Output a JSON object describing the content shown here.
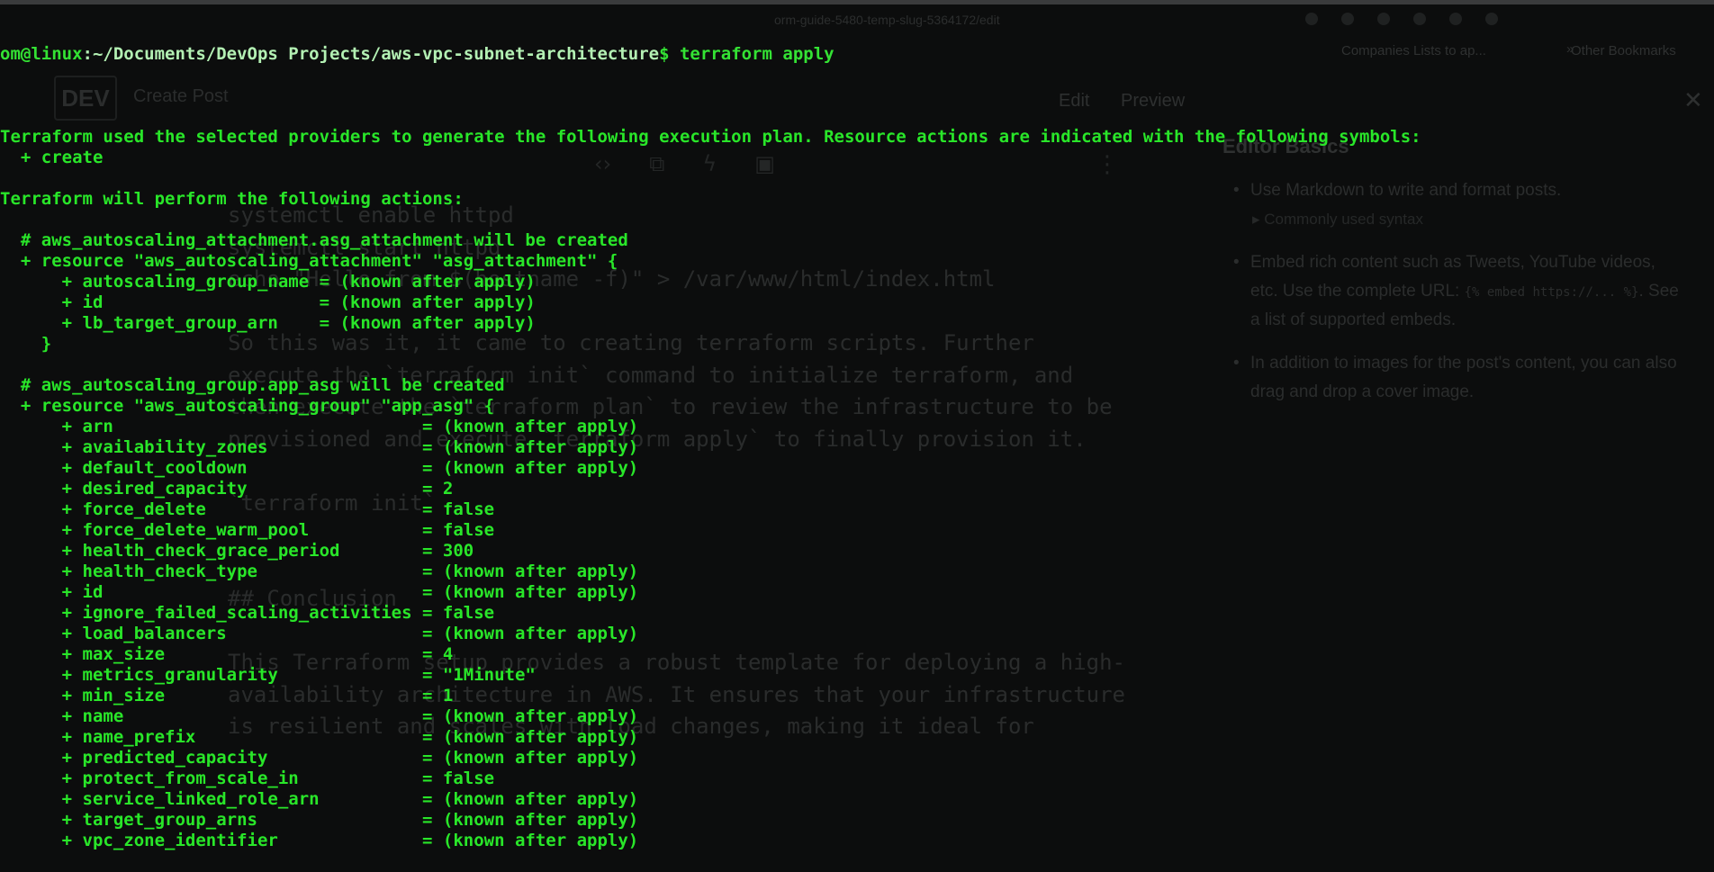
{
  "background": {
    "url_text": "orm-guide-5480-temp-slug-5364172/edit",
    "bookmarks_text": "Companies Lists to ap...",
    "other_bookmarks": "Other Bookmarks",
    "bookmarks_chevron": "»",
    "logo": "DEV",
    "create_post": "Create Post",
    "tab_edit": "Edit",
    "tab_preview": "Preview",
    "close": "✕",
    "toolbar_icons": [
      "‹›",
      "⧉",
      "ϟ",
      "▣"
    ],
    "kebab": "⋮",
    "editor_lines": [
      "systemctl enable httpd",
      "systemctl start httpd",
      "echo \"Hello from $(hostname -f)\" > /var/www/html/index.html",
      "",
      "So this was it, it came to creating terraform scripts. Further",
      "execute the `terraform init` command to initialize terraform, and",
      "then execute the `terraform plan` to review the infrastructure to be",
      "provisioned and execute `terraform apply` to finally provision it.",
      "",
      "`terraform init`",
      "",
      "",
      "## Conclusion",
      "",
      "This Terraform setup provides a robust template for deploying a high-",
      "availability architecture in AWS. It ensures that your infrastructure",
      "is resilient and scales with load changes, making it ideal for"
    ],
    "sidebar": {
      "title": "Editor Basics",
      "item1": "Use Markdown to write and format posts.",
      "item1_sub": "▸ Commonly used syntax",
      "item2_a": "Embed rich content such as Tweets, YouTube videos, etc. Use the complete URL:",
      "item2_code": "{% embed https://... %}",
      "item2_b": ". See a list of supported embeds.",
      "item3": "In addition to images for the post's content, you can also drag and drop a cover image."
    }
  },
  "terminal": {
    "prompt_user": "om@linux",
    "prompt_path": ":~/Documents/DevOps Projects/aws-vpc-subnet-architecture",
    "prompt_cmd": "$ terraform apply",
    "lines": [
      "",
      "Terraform used the selected providers to generate the following execution plan. Resource actions are indicated with the following symbols:",
      "  + create",
      "",
      "Terraform will perform the following actions:",
      "",
      "  # aws_autoscaling_attachment.asg_attachment will be created",
      "  + resource \"aws_autoscaling_attachment\" \"asg_attachment\" {",
      "      + autoscaling_group_name = (known after apply)",
      "      + id                     = (known after apply)",
      "      + lb_target_group_arn    = (known after apply)",
      "    }",
      "",
      "  # aws_autoscaling_group.app_asg will be created",
      "  + resource \"aws_autoscaling_group\" \"app_asg\" {",
      "      + arn                              = (known after apply)",
      "      + availability_zones               = (known after apply)",
      "      + default_cooldown                 = (known after apply)",
      "      + desired_capacity                 = 2",
      "      + force_delete                     = false",
      "      + force_delete_warm_pool           = false",
      "      + health_check_grace_period        = 300",
      "      + health_check_type                = (known after apply)",
      "      + id                               = (known after apply)",
      "      + ignore_failed_scaling_activities = false",
      "      + load_balancers                   = (known after apply)",
      "      + max_size                         = 4",
      "      + metrics_granularity              = \"1Minute\"",
      "      + min_size                         = 1",
      "      + name                             = (known after apply)",
      "      + name_prefix                      = (known after apply)",
      "      + predicted_capacity               = (known after apply)",
      "      + protect_from_scale_in            = false",
      "      + service_linked_role_arn          = (known after apply)",
      "      + target_group_arns                = (known after apply)",
      "      + vpc_zone_identifier              = (known after apply)"
    ]
  }
}
